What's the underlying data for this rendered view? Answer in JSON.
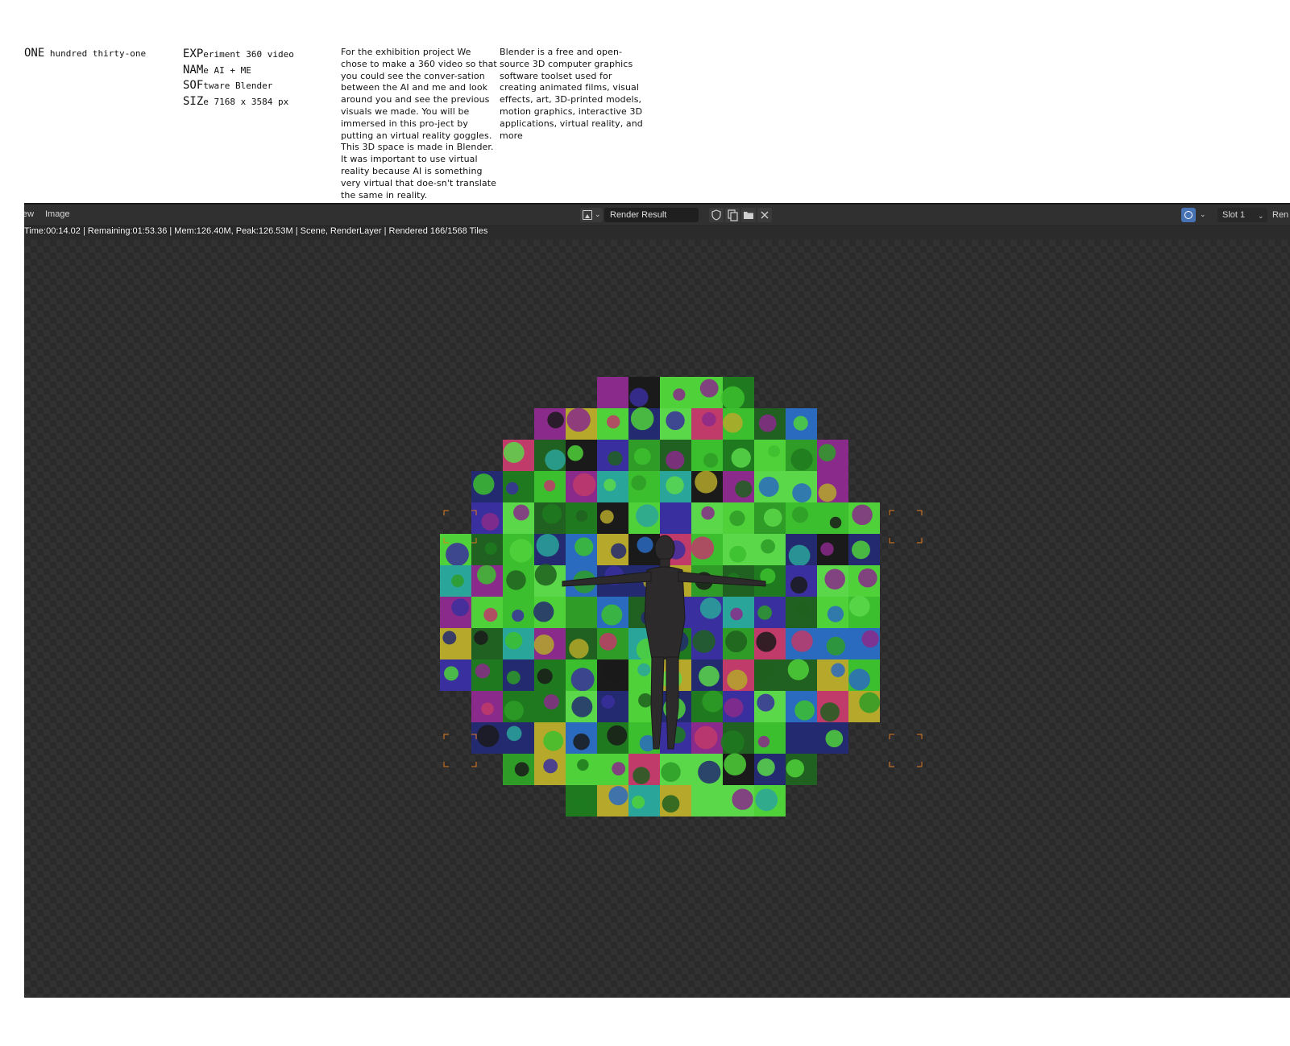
{
  "text": {
    "one": {
      "big": "ONE",
      "small": " hundred thirty-one"
    },
    "meta": [
      {
        "big": "EXP",
        "small": "eriment 360 video"
      },
      {
        "big": "NAM",
        "small": "e AI + ME"
      },
      {
        "big": "SOF",
        "small": "tware Blender"
      },
      {
        "big": "SIZ",
        "small": "e 7168 x 3584 px"
      }
    ],
    "description": "For the exhibition project We chose to make a 360 video so that you could see the conver-sation between the AI and me and look around you and see the previous visuals we made. You will be immersed in this pro-ject by putting an virtual reality goggles. This 3D space is made in Blender. It was important to use virtual reality because AI is something very virtual that doe-sn't translate the same in reality.",
    "blender_info": "Blender is a free and open-source 3D computer graphics software toolset used for creating animated films, visual effects, art, 3D-printed models, motion graphics, interactive 3D applications, virtual reality, and more"
  },
  "editor": {
    "menu": {
      "view": "ew",
      "image": "Image"
    },
    "image_name": "Render Result",
    "slot": "Slot 1",
    "render_layer": "Ren",
    "status": "Time:00:14.02 | Remaining:01:53.36 | Mem:126.40M, Peak:126.53M | Scene, RenderLayer | Rendered 166/1568 Tiles",
    "icons": {
      "image_type": "image-icon",
      "fake_user": "shield-icon",
      "duplicate": "duplicate-icon",
      "open": "folder-icon",
      "unlink": "close-icon",
      "overlays": "overlay-icon"
    },
    "colors": {
      "header_bg": "#303030",
      "canvas_bg": "#2b2b2b",
      "accent_blue": "#4772b3",
      "corner_marker": "#e07a1f"
    }
  }
}
